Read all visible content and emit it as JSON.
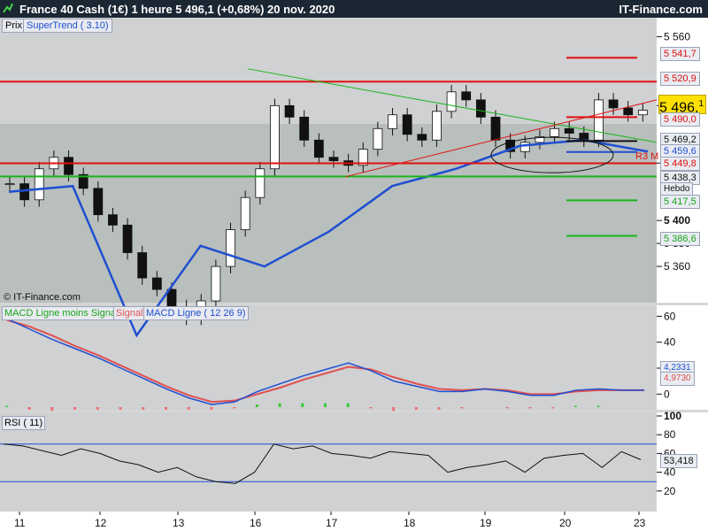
{
  "header": {
    "title": "France 40 Cash (1€)   1 heure   5 496,1 (+0,68%)   20 nov. 2020",
    "site": "IT-Finance.com"
  },
  "price_panel": {
    "tab_prix": "Prix",
    "tab_supertrend": "SuperTrend ( 3.10)",
    "watermark": "© IT-Finance.com",
    "current_price_big": "5 496,",
    "current_price_small": "1",
    "r3_label": "R3 M",
    "hebdo_label": "Hebdo",
    "ytick_labels": [
      "5 560",
      "5 500",
      "5 450",
      "5 400",
      "5 380",
      "5 360"
    ],
    "level_labels": [
      "5 541,7",
      "5 520,9",
      "5 490,0",
      "5 469,2",
      "5 459,6",
      "5 449,8",
      "5 438,3",
      "5 417,5",
      "5 386,6"
    ],
    "colors": {
      "supertrend_up": "#1f4fd1",
      "supertrend_down": "#ff1010",
      "support_green": "#19b519",
      "resistance_red": "#e01010",
      "current": "#ffe000"
    }
  },
  "macd_panel": {
    "legend_a": "MACD Ligne moins Signal",
    "legend_b": "Signal",
    "legend_c": "MACD Ligne ( 12 26 9)",
    "ytick_labels": [
      "60",
      "40",
      "20",
      "0"
    ],
    "value_labels": [
      "4,2331",
      "4,9730"
    ]
  },
  "rsi_panel": {
    "legend": "RSI ( 11)",
    "ytick_labels": [
      "100",
      "80",
      "60",
      "40",
      "20"
    ],
    "current_value": "53,418"
  },
  "xaxis": {
    "labels": [
      "11",
      "12",
      "13",
      "16",
      "17",
      "18",
      "19",
      "20",
      "23"
    ]
  },
  "chart_data": {
    "type": "line",
    "subtype": "candlestick",
    "title": "France 40 Cash (1€)   1 heure   5 496,1 (+0,68%)   20 nov. 2020",
    "x": [
      "11",
      "12",
      "13",
      "16",
      "17",
      "18",
      "19",
      "20",
      "23"
    ],
    "close": [
      5432,
      5418,
      5445,
      5455,
      5440,
      5428,
      5405,
      5396,
      5372,
      5350,
      5340,
      5325,
      5315,
      5330,
      5360,
      5392,
      5420,
      5445,
      5500,
      5490,
      5470,
      5455,
      5452,
      5448,
      5462,
      5480,
      5492,
      5475,
      5470,
      5495,
      5512,
      5505,
      5490,
      5470,
      5460,
      5468,
      5473,
      5480,
      5476,
      5470,
      5505,
      5498,
      5492,
      5496
    ],
    "supertrend_levels": [
      5425,
      5430,
      5300,
      5378,
      5360,
      5390,
      5430,
      5445,
      5465,
      5470,
      5460
    ],
    "levels": [
      5541.7,
      5520.9,
      5490.0,
      5469.2,
      5459.6,
      5449.8,
      5438.3,
      5417.5,
      5386.6
    ],
    "ylim": [
      5330,
      5575
    ],
    "macd": {
      "ylim": [
        -10,
        65
      ],
      "values": [
        58,
        50,
        42,
        35,
        28,
        20,
        12,
        4,
        -3,
        -8,
        -6,
        2,
        8,
        14,
        19,
        24,
        18,
        10,
        6,
        2,
        2,
        4,
        2,
        -1,
        -1,
        3,
        4,
        3,
        3
      ],
      "signal": [
        57,
        52,
        45,
        37,
        30,
        22,
        14,
        6,
        -1,
        -6,
        -5,
        0,
        5,
        11,
        16,
        21,
        19,
        13,
        8,
        4,
        3,
        4,
        3,
        0,
        0,
        2,
        3,
        3,
        3
      ]
    },
    "rsi": {
      "ylim": [
        0,
        100
      ],
      "values": [
        70,
        68,
        63,
        58,
        65,
        60,
        52,
        48,
        40,
        45,
        35,
        30,
        28,
        40,
        70,
        65,
        68,
        60,
        58,
        55,
        62,
        60,
        58,
        40,
        45,
        48,
        52,
        40,
        55,
        58,
        60,
        45,
        62,
        53.4
      ],
      "bands": [
        70,
        30
      ]
    }
  }
}
